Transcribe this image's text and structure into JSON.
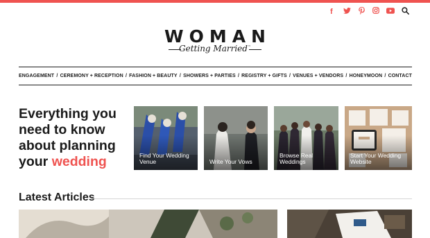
{
  "colors": {
    "accent": "#ef5350",
    "text": "#1a1a1a"
  },
  "social": [
    {
      "name": "facebook-icon",
      "glyph": "f"
    },
    {
      "name": "twitter-icon",
      "glyph": ""
    },
    {
      "name": "pinterest-icon",
      "glyph": ""
    },
    {
      "name": "instagram-icon",
      "glyph": ""
    },
    {
      "name": "youtube-icon",
      "glyph": ""
    },
    {
      "name": "search-icon",
      "glyph": ""
    }
  ],
  "logo": {
    "top": "WOMAN",
    "bottom": "Getting Married",
    "mark": "™"
  },
  "nav": {
    "items": [
      "ENGAGEMENT",
      "CEREMONY + RECEPTION",
      "FASHION + BEAUTY",
      "SHOWERS + PARTIES",
      "REGISTRY + GIFTS",
      "VENUES + VENDORS",
      "HONEYMOON",
      "CONTACT"
    ],
    "separator": "/"
  },
  "hero": {
    "line1": "Everything you need to know about planning your ",
    "accent": "wedding"
  },
  "cards": [
    {
      "label": "Find Your Wedding Venue"
    },
    {
      "label": "Write Your Vows"
    },
    {
      "label": "Browse Real Weddings"
    },
    {
      "label": "Start Your Wedding Website"
    }
  ],
  "latest": {
    "title": "Latest Articles"
  }
}
